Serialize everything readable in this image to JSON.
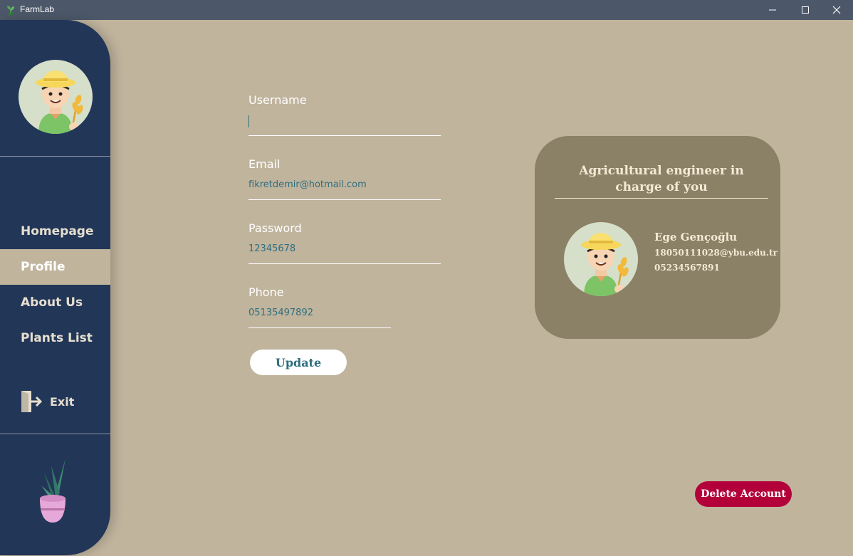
{
  "window": {
    "title": "FarmLab"
  },
  "nav": {
    "items": [
      {
        "label": "Homepage"
      },
      {
        "label": "Profile",
        "active": true
      },
      {
        "label": "About Us"
      },
      {
        "label": "Plants List"
      }
    ],
    "exit_label": "Exit"
  },
  "form": {
    "username": {
      "label": "Username",
      "value": ""
    },
    "email": {
      "label": "Email",
      "value": "fikretdemir@hotmail.com"
    },
    "password": {
      "label": "Password",
      "value": "12345678"
    },
    "phone": {
      "label": "Phone",
      "value": "05135497892"
    },
    "update_label": "Update"
  },
  "engineer": {
    "heading": "Agricultural engineer in charge of you",
    "name": "Ege Gençoğlu",
    "email": "18050111028@ybu.edu.tr",
    "phone": "05234567891"
  },
  "delete_label": "Delete Account",
  "colors": {
    "sidebar": "#223658",
    "background": "#c0b49d",
    "card": "#8b8166",
    "accent_text": "#2f6e7e",
    "delete": "#b3003a"
  },
  "icons": [
    "app-plant-icon",
    "minimize-icon",
    "maximize-icon",
    "close-icon",
    "farmer-avatar",
    "exit-door-icon",
    "potted-plant-illustration"
  ]
}
